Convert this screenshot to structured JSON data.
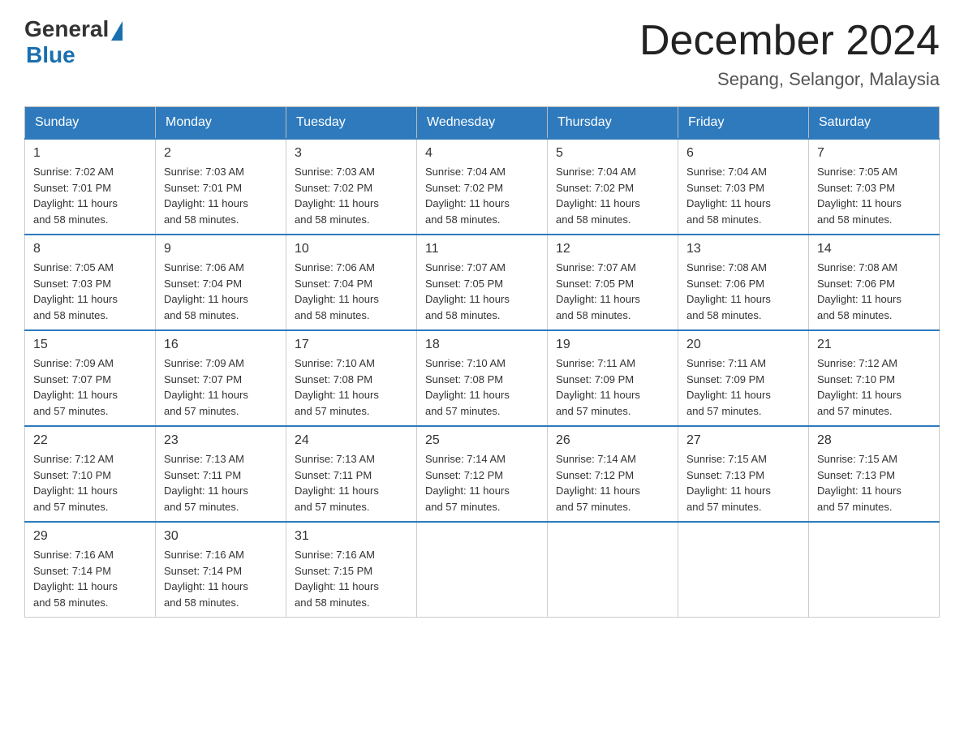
{
  "header": {
    "logo_general": "General",
    "logo_blue": "Blue",
    "month_title": "December 2024",
    "location": "Sepang, Selangor, Malaysia"
  },
  "days_of_week": [
    "Sunday",
    "Monday",
    "Tuesday",
    "Wednesday",
    "Thursday",
    "Friday",
    "Saturday"
  ],
  "weeks": [
    [
      {
        "day": "1",
        "sunrise": "7:02 AM",
        "sunset": "7:01 PM",
        "daylight": "11 hours and 58 minutes."
      },
      {
        "day": "2",
        "sunrise": "7:03 AM",
        "sunset": "7:01 PM",
        "daylight": "11 hours and 58 minutes."
      },
      {
        "day": "3",
        "sunrise": "7:03 AM",
        "sunset": "7:02 PM",
        "daylight": "11 hours and 58 minutes."
      },
      {
        "day": "4",
        "sunrise": "7:04 AM",
        "sunset": "7:02 PM",
        "daylight": "11 hours and 58 minutes."
      },
      {
        "day": "5",
        "sunrise": "7:04 AM",
        "sunset": "7:02 PM",
        "daylight": "11 hours and 58 minutes."
      },
      {
        "day": "6",
        "sunrise": "7:04 AM",
        "sunset": "7:03 PM",
        "daylight": "11 hours and 58 minutes."
      },
      {
        "day": "7",
        "sunrise": "7:05 AM",
        "sunset": "7:03 PM",
        "daylight": "11 hours and 58 minutes."
      }
    ],
    [
      {
        "day": "8",
        "sunrise": "7:05 AM",
        "sunset": "7:03 PM",
        "daylight": "11 hours and 58 minutes."
      },
      {
        "day": "9",
        "sunrise": "7:06 AM",
        "sunset": "7:04 PM",
        "daylight": "11 hours and 58 minutes."
      },
      {
        "day": "10",
        "sunrise": "7:06 AM",
        "sunset": "7:04 PM",
        "daylight": "11 hours and 58 minutes."
      },
      {
        "day": "11",
        "sunrise": "7:07 AM",
        "sunset": "7:05 PM",
        "daylight": "11 hours and 58 minutes."
      },
      {
        "day": "12",
        "sunrise": "7:07 AM",
        "sunset": "7:05 PM",
        "daylight": "11 hours and 58 minutes."
      },
      {
        "day": "13",
        "sunrise": "7:08 AM",
        "sunset": "7:06 PM",
        "daylight": "11 hours and 58 minutes."
      },
      {
        "day": "14",
        "sunrise": "7:08 AM",
        "sunset": "7:06 PM",
        "daylight": "11 hours and 58 minutes."
      }
    ],
    [
      {
        "day": "15",
        "sunrise": "7:09 AM",
        "sunset": "7:07 PM",
        "daylight": "11 hours and 57 minutes."
      },
      {
        "day": "16",
        "sunrise": "7:09 AM",
        "sunset": "7:07 PM",
        "daylight": "11 hours and 57 minutes."
      },
      {
        "day": "17",
        "sunrise": "7:10 AM",
        "sunset": "7:08 PM",
        "daylight": "11 hours and 57 minutes."
      },
      {
        "day": "18",
        "sunrise": "7:10 AM",
        "sunset": "7:08 PM",
        "daylight": "11 hours and 57 minutes."
      },
      {
        "day": "19",
        "sunrise": "7:11 AM",
        "sunset": "7:09 PM",
        "daylight": "11 hours and 57 minutes."
      },
      {
        "day": "20",
        "sunrise": "7:11 AM",
        "sunset": "7:09 PM",
        "daylight": "11 hours and 57 minutes."
      },
      {
        "day": "21",
        "sunrise": "7:12 AM",
        "sunset": "7:10 PM",
        "daylight": "11 hours and 57 minutes."
      }
    ],
    [
      {
        "day": "22",
        "sunrise": "7:12 AM",
        "sunset": "7:10 PM",
        "daylight": "11 hours and 57 minutes."
      },
      {
        "day": "23",
        "sunrise": "7:13 AM",
        "sunset": "7:11 PM",
        "daylight": "11 hours and 57 minutes."
      },
      {
        "day": "24",
        "sunrise": "7:13 AM",
        "sunset": "7:11 PM",
        "daylight": "11 hours and 57 minutes."
      },
      {
        "day": "25",
        "sunrise": "7:14 AM",
        "sunset": "7:12 PM",
        "daylight": "11 hours and 57 minutes."
      },
      {
        "day": "26",
        "sunrise": "7:14 AM",
        "sunset": "7:12 PM",
        "daylight": "11 hours and 57 minutes."
      },
      {
        "day": "27",
        "sunrise": "7:15 AM",
        "sunset": "7:13 PM",
        "daylight": "11 hours and 57 minutes."
      },
      {
        "day": "28",
        "sunrise": "7:15 AM",
        "sunset": "7:13 PM",
        "daylight": "11 hours and 57 minutes."
      }
    ],
    [
      {
        "day": "29",
        "sunrise": "7:16 AM",
        "sunset": "7:14 PM",
        "daylight": "11 hours and 58 minutes."
      },
      {
        "day": "30",
        "sunrise": "7:16 AM",
        "sunset": "7:14 PM",
        "daylight": "11 hours and 58 minutes."
      },
      {
        "day": "31",
        "sunrise": "7:16 AM",
        "sunset": "7:15 PM",
        "daylight": "11 hours and 58 minutes."
      },
      null,
      null,
      null,
      null
    ]
  ],
  "labels": {
    "sunrise": "Sunrise:",
    "sunset": "Sunset:",
    "daylight": "Daylight:"
  }
}
